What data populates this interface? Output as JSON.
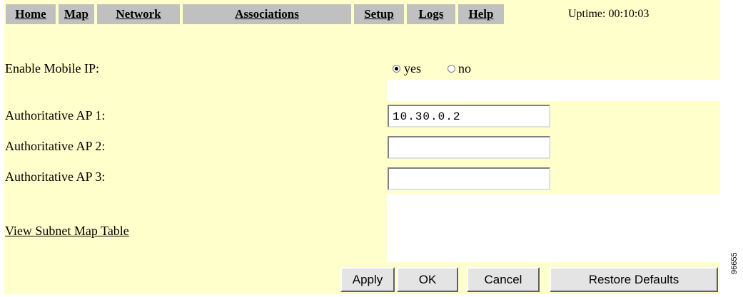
{
  "nav": {
    "items": [
      "Home",
      "Map",
      "Network",
      "Associations",
      "Setup",
      "Logs",
      "Help"
    ],
    "uptime": "Uptime: 00:10:03"
  },
  "form": {
    "mobile_ip_label": "Enable Mobile IP:",
    "mobile_ip_yes": "yes",
    "mobile_ip_no": "no",
    "mobile_ip_selected": "yes",
    "ap1_label": "Authoritative AP 1:",
    "ap1_value": "10.30.0.2",
    "ap2_label": "Authoritative AP 2:",
    "ap2_value": "",
    "ap3_label": "Authoritative AP 3:",
    "ap3_value": "",
    "subnet_link": "View Subnet Map Table"
  },
  "buttons": {
    "apply": "Apply",
    "ok": "OK",
    "cancel": "Cancel",
    "restore": "Restore Defaults"
  },
  "figure_number": "96655"
}
